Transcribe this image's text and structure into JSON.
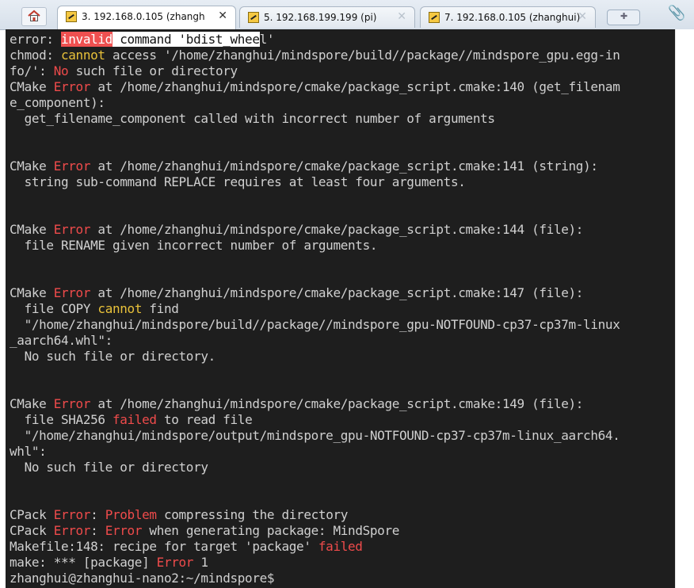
{
  "tabs": [
    {
      "label": "3. 192.168.0.105 (zhanghui",
      "active": true
    },
    {
      "label": "5. 192.168.199.199 (pi)",
      "active": false
    },
    {
      "label": "7. 192.168.0.105 (zhanghui)",
      "active": false
    }
  ],
  "close_glyph": "✕",
  "new_tab_glyph": "✚",
  "attach_glyph": "📎",
  "terminal": {
    "l1": {
      "a": "error: ",
      "b": "invalid",
      "c": " command 'bdist_whee",
      "d": "l'"
    },
    "l2": {
      "a": "chmod: ",
      "b": "cannot",
      "c": " access '/home/zhanghui/mindspore/build//package//mindspore_gpu.egg-in"
    },
    "l3": {
      "a": "fo/': ",
      "b": "No",
      "c": " such file or directory"
    },
    "l4": {
      "a": "CMake ",
      "b": "Error",
      "c": " at /home/zhanghui/mindspore/cmake/package_script.cmake:140 (get_filenam"
    },
    "l5": "e_component):",
    "l6": "  get_filename_component called with incorrect number of arguments",
    "l7": {
      "a": "CMake ",
      "b": "Error",
      "c": " at /home/zhanghui/mindspore/cmake/package_script.cmake:141 (string):"
    },
    "l8": "  string sub-command REPLACE requires at least four arguments.",
    "l9": {
      "a": "CMake ",
      "b": "Error",
      "c": " at /home/zhanghui/mindspore/cmake/package_script.cmake:144 (file):"
    },
    "l10": "  file RENAME given incorrect number of arguments.",
    "l11": {
      "a": "CMake ",
      "b": "Error",
      "c": " at /home/zhanghui/mindspore/cmake/package_script.cmake:147 (file):"
    },
    "l12": {
      "a": "  file COPY ",
      "b": "cannot",
      "c": " find"
    },
    "l13": "  \"/home/zhanghui/mindspore/build//package//mindspore_gpu-NOTFOUND-cp37-cp37m-linux",
    "l14": "_aarch64.whl\":",
    "l15": "  No such file or directory.",
    "l16": {
      "a": "CMake ",
      "b": "Error",
      "c": " at /home/zhanghui/mindspore/cmake/package_script.cmake:149 (file):"
    },
    "l17": {
      "a": "  file SHA256 ",
      "b": "failed",
      "c": " to read file"
    },
    "l18": "  \"/home/zhanghui/mindspore/output/mindspore_gpu-NOTFOUND-cp37-cp37m-linux_aarch64.",
    "l19": "whl\":",
    "l20": "  No such file or directory",
    "l21": {
      "a": "CPack ",
      "b": "Error",
      "c": ": ",
      "d": "Problem",
      "e": " compressing the directory"
    },
    "l22": {
      "a": "CPack ",
      "b": "Error",
      "c": ": ",
      "d": "Error",
      "e": " when generating package: MindSpore"
    },
    "l23": {
      "a": "Makefile:148: recipe for target 'package' ",
      "b": "failed"
    },
    "l24": {
      "a": "make: *** [package] ",
      "b": "Error",
      "c": " 1"
    },
    "l25": "zhanghui@zhanghui-nano2:~/mindspore$"
  }
}
